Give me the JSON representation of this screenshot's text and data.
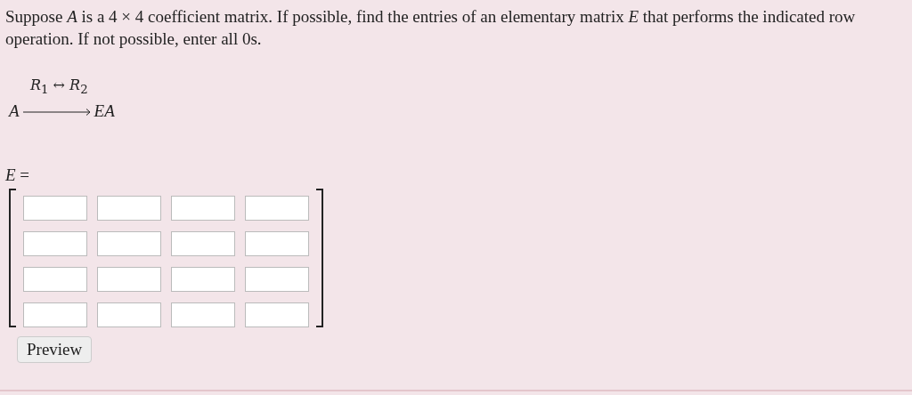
{
  "question": "Suppose *A* is a 4 × 4 coefficient matrix. If possible, find the entries of an elementary matrix *E* that performs the indicated row operation. If not possible, enter all 0s.",
  "operation": {
    "label": "*R*$_{1}$ ↔ *R*$_{2}$",
    "from": "A",
    "to": "EA"
  },
  "answer_label": "*E* =",
  "matrix": {
    "rows": [
      {
        "cells": [
          {
            "kind": "blank"
          },
          {
            "kind": "blank"
          },
          {
            "kind": "blank"
          },
          {
            "kind": "blank"
          }
        ]
      },
      {
        "cells": [
          {
            "kind": "blank"
          },
          {
            "kind": "blank"
          },
          {
            "kind": "blank"
          },
          {
            "kind": "blank"
          }
        ]
      },
      {
        "cells": [
          {
            "kind": "blank"
          },
          {
            "kind": "blank"
          },
          {
            "kind": "blank"
          },
          {
            "kind": "blank"
          }
        ]
      },
      {
        "cells": [
          {
            "kind": "blank"
          },
          {
            "kind": "blank"
          },
          {
            "kind": "blank"
          },
          {
            "kind": "blank"
          }
        ]
      }
    ]
  },
  "buttons": [
    "Preview"
  ]
}
